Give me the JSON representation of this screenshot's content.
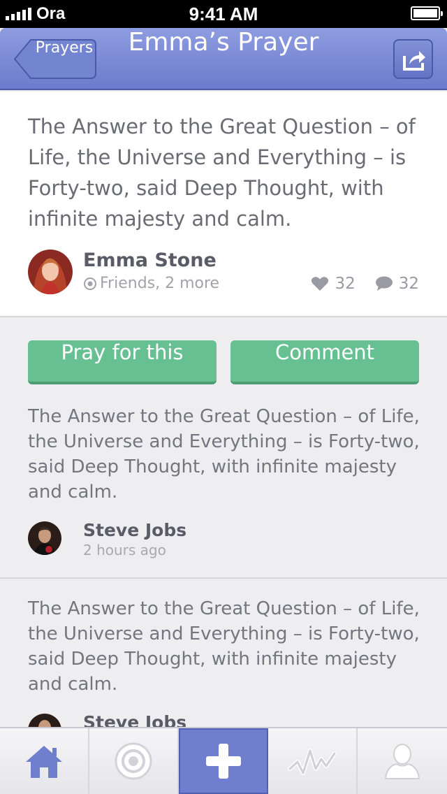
{
  "status_bar": {
    "carrier": "Ora",
    "time": "9:41 AM"
  },
  "nav": {
    "back_label": "Prayers",
    "title": "Emma’s Prayer",
    "share_icon": "share-icon"
  },
  "prayer": {
    "text": "The Answer to the Great Question – of Life, the Universe and Everything – is Forty-two, said Deep Thought, with infinite majesty and calm.",
    "author": "Emma Stone",
    "audience": "Friends, 2 more",
    "likes": "32",
    "comments": "32"
  },
  "actions": {
    "pray_label": "Pray for this",
    "comment_label": "Comment"
  },
  "comments": [
    {
      "text": "The Answer to the Great Question – of Life, the Universe and Everything – is Forty-two, said Deep Thought, with infinite majesty and calm.",
      "author": "Steve Jobs",
      "time": "2 hours ago"
    },
    {
      "text": "The Answer to the Great Question – of Life, the Universe and Everything – is Forty-two, said Deep Thought, with infinite majesty and calm.",
      "author": "Steve Jobs",
      "time": ""
    }
  ],
  "tabs": [
    {
      "icon": "home-icon",
      "active": false
    },
    {
      "icon": "target-icon",
      "active": false
    },
    {
      "icon": "plus-icon",
      "active": true
    },
    {
      "icon": "activity-icon",
      "active": false
    },
    {
      "icon": "profile-icon",
      "active": false
    }
  ],
  "colors": {
    "nav": "#7281d2",
    "accent_green": "#67c092",
    "active_tab": "#6f7fcd"
  }
}
